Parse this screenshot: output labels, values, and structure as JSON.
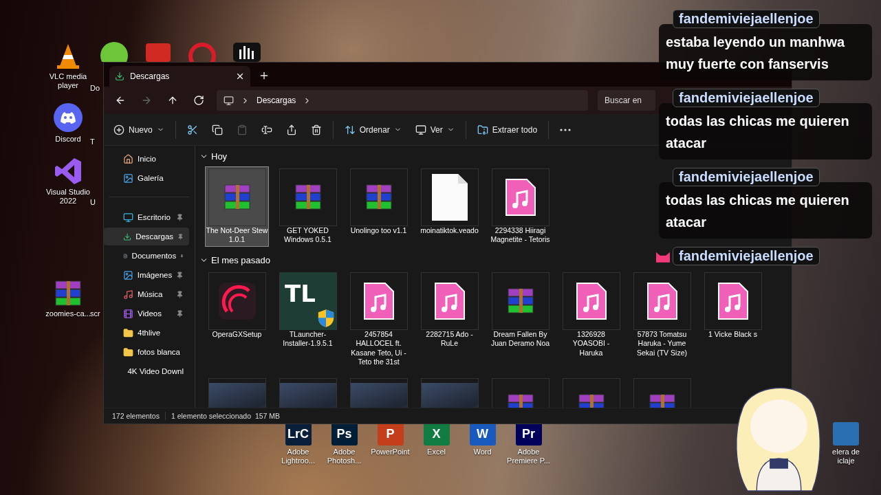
{
  "desktop": {
    "left_icons": [
      {
        "label": "VLC media player",
        "kind": "vlc"
      },
      {
        "label": "Discord",
        "kind": "discord"
      },
      {
        "label": "Visual Studio 2022",
        "kind": "vs"
      },
      {
        "label": "zoomies-ca...",
        "kind": "rar"
      }
    ],
    "partial_labels": [
      "Do",
      "T",
      "U",
      "scr"
    ],
    "top_icons": [
      {
        "kind": "green"
      },
      {
        "kind": "pdf"
      },
      {
        "kind": "opera"
      },
      {
        "kind": "bars"
      }
    ],
    "bottom_icons": [
      {
        "label": "Adobe Lightroo...",
        "glyph": "LrC",
        "color": "#0a1f3a"
      },
      {
        "label": "Adobe Photosh...",
        "glyph": "Ps",
        "color": "#001e36"
      },
      {
        "label": "PowerPoint",
        "glyph": "P",
        "color": "#c43e1c"
      },
      {
        "label": "Excel",
        "glyph": "X",
        "color": "#107c41"
      },
      {
        "label": "Word",
        "glyph": "W",
        "color": "#185abd"
      },
      {
        "label": "Adobe Premiere P...",
        "glyph": "Pr",
        "color": "#00005b"
      },
      {
        "label": "elera de iclaje",
        "color": "#2b6fb3"
      }
    ]
  },
  "explorer": {
    "tab": {
      "title": "Descargas"
    },
    "nav": [
      {
        "kind": "back",
        "disabled": false
      },
      {
        "kind": "forward",
        "disabled": true
      },
      {
        "kind": "up",
        "disabled": false
      },
      {
        "kind": "refresh",
        "disabled": false
      }
    ],
    "path": [
      "Descargas"
    ],
    "search": {
      "placeholder": "Buscar en"
    },
    "toolbar": [
      {
        "kind": "new",
        "label": "Nuevo",
        "dropdown": true,
        "disabled": false
      },
      {
        "kind": "cut",
        "disabled": false
      },
      {
        "kind": "copy",
        "disabled": false
      },
      {
        "kind": "paste",
        "disabled": true
      },
      {
        "kind": "rename",
        "disabled": false
      },
      {
        "kind": "share",
        "disabled": false
      },
      {
        "kind": "delete",
        "disabled": false
      },
      {
        "kind": "sort",
        "label": "Ordenar",
        "dropdown": true,
        "disabled": false
      },
      {
        "kind": "view",
        "label": "Ver",
        "dropdown": true,
        "disabled": false
      },
      {
        "kind": "extract",
        "label": "Extraer todo",
        "dropdown": false,
        "disabled": false
      },
      {
        "kind": "more",
        "disabled": false
      }
    ],
    "sidebar": [
      [
        {
          "label": "Inicio",
          "kind": "home",
          "pinned": false,
          "selected": false
        },
        {
          "label": "Galería",
          "kind": "gallery",
          "pinned": false,
          "selected": false
        }
      ],
      [
        {
          "label": "Escritorio",
          "kind": "desktop",
          "pinned": true,
          "selected": false
        },
        {
          "label": "Descargas",
          "kind": "download",
          "pinned": true,
          "selected": true
        },
        {
          "label": "Documentos",
          "kind": "docs",
          "pinned": true,
          "selected": false
        },
        {
          "label": "Imágenes",
          "kind": "gallery",
          "pinned": true,
          "selected": false
        },
        {
          "label": "Música",
          "kind": "music",
          "pinned": true,
          "selected": false
        },
        {
          "label": "Videos",
          "kind": "video",
          "pinned": true,
          "selected": false
        },
        {
          "label": "4thlive",
          "kind": "folder",
          "pinned": false,
          "selected": false
        },
        {
          "label": "fotos blanca",
          "kind": "folder",
          "pinned": false,
          "selected": false
        },
        {
          "label": "4K Video Downl",
          "kind": "folder",
          "pinned": false,
          "selected": false
        }
      ]
    ],
    "groups": [
      {
        "title": "Hoy",
        "expanded": true,
        "files": [
          {
            "label": "The Not-Deer Stew 1.0.1",
            "kind": "rar",
            "selected": true
          },
          {
            "label": "GET YOKED Windows 0.5.1",
            "kind": "rar",
            "selected": false
          },
          {
            "label": "Unolingo too v1.1",
            "kind": "rar",
            "selected": false
          },
          {
            "label": "moinatiktok.veado",
            "kind": "blank",
            "selected": false
          },
          {
            "label": "2294338 Hiiragi Magnetite - Tetoris",
            "kind": "music",
            "selected": false
          }
        ]
      },
      {
        "title": "El mes pasado",
        "expanded": true,
        "files": [
          {
            "label": "OperaGXSetup",
            "kind": "opera",
            "selected": false
          },
          {
            "label": "TLauncher-Installer-1.9.5.1",
            "kind": "tl",
            "glyph": "TL",
            "selected": false
          },
          {
            "label": "2457854 HALLOCEL ft. Kasane Teto, Ui - Teto the 31st",
            "kind": "music",
            "selected": false
          },
          {
            "label": "2282715 Ado - RuLe",
            "kind": "music",
            "selected": false
          },
          {
            "label": "Dream Fallen By Juan Deramo Noa",
            "kind": "rar",
            "selected": false
          },
          {
            "label": "1326928 YOASOBI - Haruka",
            "kind": "music",
            "selected": false
          },
          {
            "label": "57873 Tomatsu Haruka - Yume Sekai (TV Size)",
            "kind": "music",
            "selected": false
          },
          {
            "label": "1 Vicke Black s",
            "kind": "music",
            "selected": false
          },
          {
            "kind": "photo",
            "selected": false
          },
          {
            "kind": "photo",
            "selected": false
          },
          {
            "kind": "photo",
            "selected": false
          },
          {
            "kind": "photo",
            "selected": false
          },
          {
            "kind": "rar",
            "selected": false
          },
          {
            "kind": "rar",
            "selected": false
          },
          {
            "kind": "rar",
            "selected": false
          }
        ]
      }
    ],
    "status_bar": {
      "count": "172 elementos",
      "selection": "1 elemento seleccionado  157 MB"
    }
  },
  "chat": [
    {
      "user": "fandemiviejaellenjoe",
      "kind": "text",
      "text": "estaba leyendo un manhwa muy fuerte con fanservis"
    },
    {
      "user": "fandemiviejaellenjoe",
      "kind": "text",
      "text": "todas las chicas me quieren atacar"
    },
    {
      "user": "fandemiviejaellenjoe",
      "kind": "text",
      "text": "todas las chicas me quieren atacar"
    },
    {
      "user": "fandemiviejaellenjoe",
      "kind": "emote"
    }
  ]
}
